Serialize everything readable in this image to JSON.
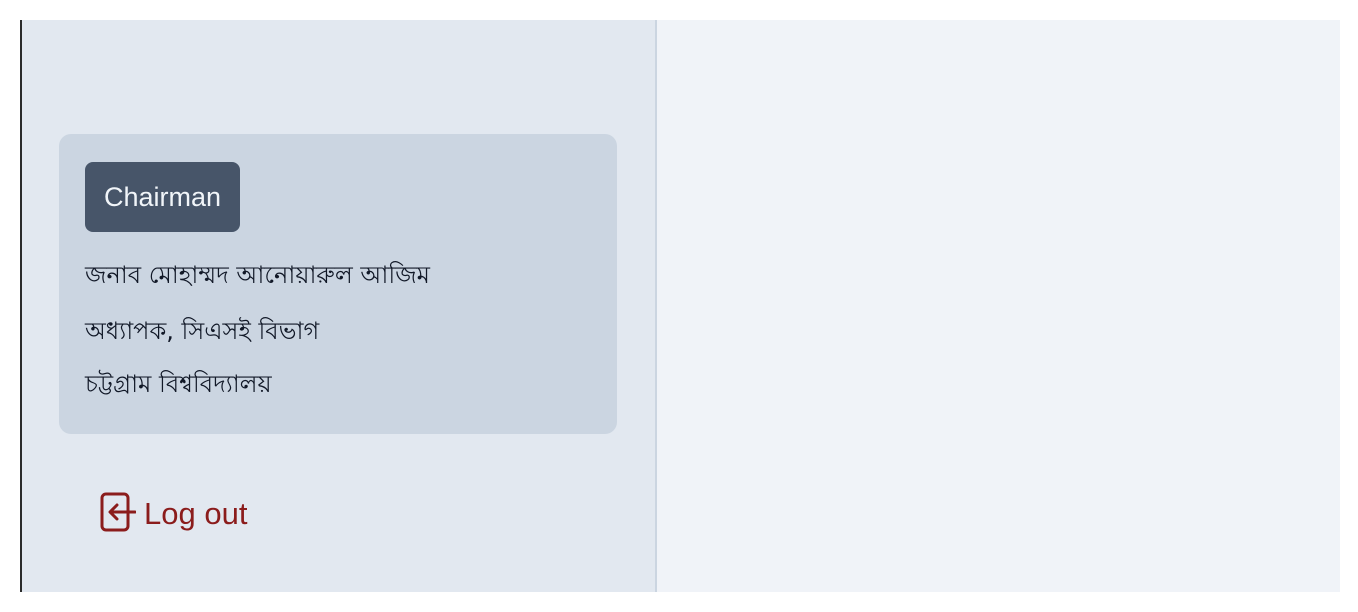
{
  "sidebar": {
    "profile": {
      "role_badge": "Chairman",
      "name": "জনাব মোহাম্মদ আনোয়ারুল আজিম",
      "designation": "অধ্যাপক, সিএসই বিভাগ",
      "institution": "চট্টগ্রাম বিশ্ববিদ্যালয়"
    },
    "logout": {
      "label": "Log out",
      "icon": "logout-icon",
      "color": "#8b1c1c"
    }
  },
  "colors": {
    "sidebar_bg": "#e2e8f0",
    "card_bg": "#cbd5e1",
    "badge_bg": "#475569",
    "main_bg": "#f0f3f8"
  }
}
